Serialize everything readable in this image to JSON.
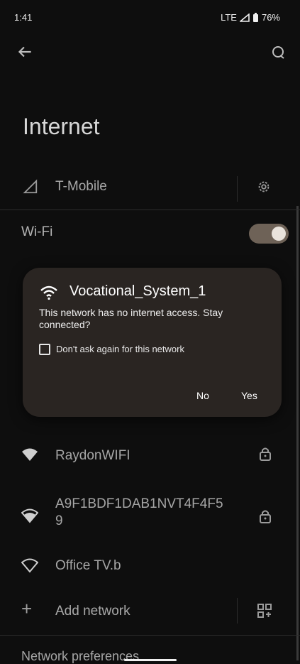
{
  "status_bar": {
    "time": "1:41",
    "network": "LTE",
    "battery": "76%"
  },
  "page": {
    "title": "Internet"
  },
  "carrier": {
    "name": "T-Mobile"
  },
  "wifi": {
    "label": "Wi-Fi",
    "enabled": true
  },
  "dialog": {
    "ssid": "Vocational_System_1",
    "message": "This network has no internet access. Stay connected?",
    "checkbox_label": "Don't ask again for this network",
    "no_label": "No",
    "yes_label": "Yes"
  },
  "networks": [
    {
      "name": "RaydonWIFI",
      "secured": true
    },
    {
      "name": "A9F1BDF1DAB1NVT4F4F5",
      "name_line2": "9",
      "secured": true
    },
    {
      "name": "Office TV.b",
      "secured": false
    }
  ],
  "add_network": {
    "label": "Add network"
  },
  "preferences": {
    "label": "Network preferences"
  },
  "colors": {
    "background": "#0e0e0e",
    "dialog_bg": "#2a2522",
    "toggle_track": "#6e6257"
  }
}
